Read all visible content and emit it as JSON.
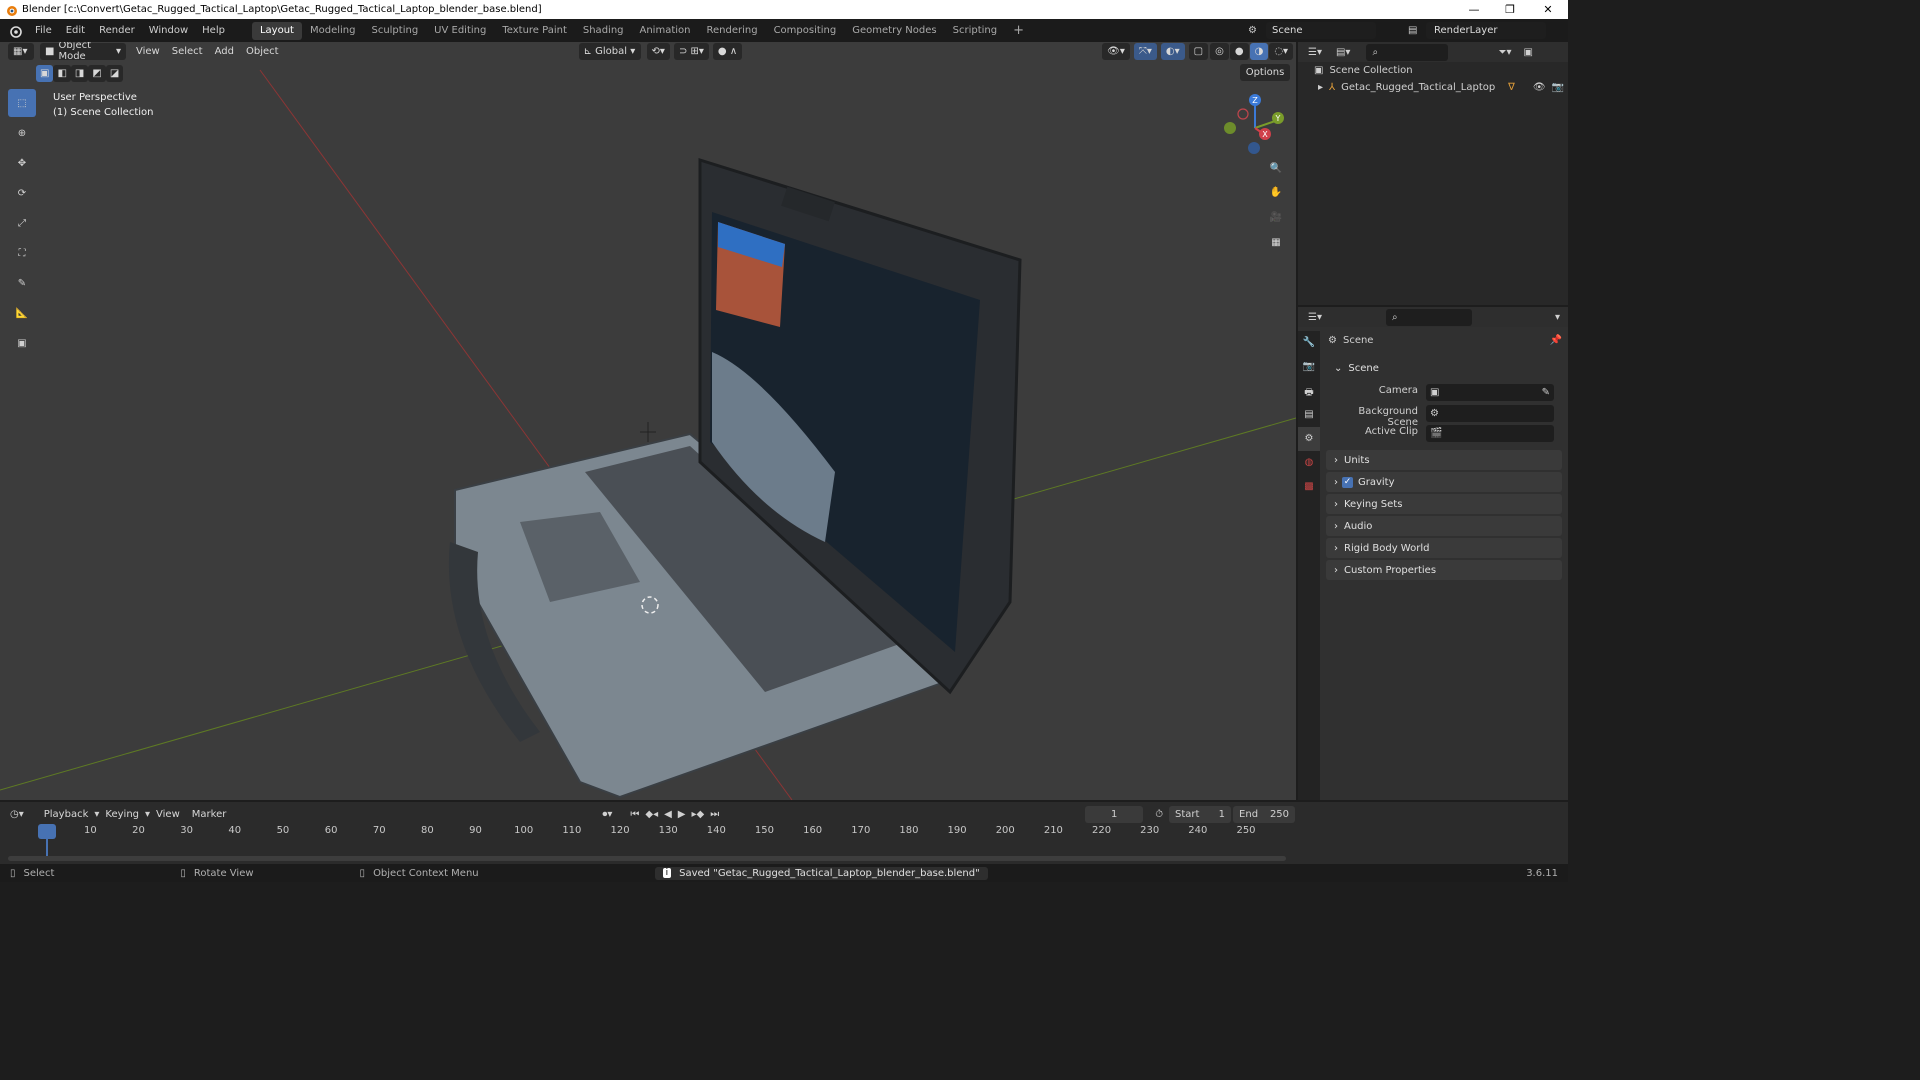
{
  "window": {
    "title": "Blender [c:\\Convert\\Getac_Rugged_Tactical_Laptop\\Getac_Rugged_Tactical_Laptop_blender_base.blend]"
  },
  "menu": {
    "items": [
      "File",
      "Edit",
      "Render",
      "Window",
      "Help"
    ]
  },
  "workspaces": [
    "Layout",
    "Modeling",
    "Sculpting",
    "UV Editing",
    "Texture Paint",
    "Shading",
    "Animation",
    "Rendering",
    "Compositing",
    "Geometry Nodes",
    "Scripting"
  ],
  "scene_selector": {
    "label": "Scene"
  },
  "view_layer": {
    "label": "RenderLayer"
  },
  "viewport": {
    "mode": "Object Mode",
    "menus": [
      "View",
      "Select",
      "Add",
      "Object"
    ],
    "orientation": "Global",
    "options_label": "Options",
    "overlay_line1": "User Perspective",
    "overlay_line2": "(1) Scene Collection",
    "gizmo_axes": {
      "x": "X",
      "y": "Y",
      "z": "Z"
    }
  },
  "outliner": {
    "root": "Scene Collection",
    "items": [
      {
        "label": "Getac_Rugged_Tactical_Laptop"
      }
    ]
  },
  "properties": {
    "header": "Scene",
    "panel_scene": "Scene",
    "fields": {
      "camera": "Camera",
      "background_scene": "Background Scene",
      "active_clip": "Active Clip"
    },
    "panels": [
      "Units",
      "Gravity",
      "Keying Sets",
      "Audio",
      "Rigid Body World",
      "Custom Properties"
    ],
    "gravity_checked": true
  },
  "timeline": {
    "menus": [
      "Playback",
      "Keying",
      "View",
      "Marker"
    ],
    "current_frame": "1",
    "start_label": "Start",
    "start": "1",
    "end_label": "End",
    "end": "250",
    "ticks": [
      "1",
      "10",
      "20",
      "30",
      "40",
      "50",
      "60",
      "70",
      "80",
      "90",
      "100",
      "110",
      "120",
      "130",
      "140",
      "150",
      "160",
      "170",
      "180",
      "190",
      "200",
      "210",
      "220",
      "230",
      "240",
      "250"
    ]
  },
  "status": {
    "select": "Select",
    "rotate": "Rotate View",
    "context": "Object Context Menu",
    "message": "Saved \"Getac_Rugged_Tactical_Laptop_blender_base.blend\"",
    "version": "3.6.11"
  },
  "colors": {
    "accent": "#4772b3",
    "x_axis": "#d0404a",
    "y_axis": "#7a9c2a",
    "z_axis": "#3b7ad8",
    "viewport_bg": "#3c3c3c"
  }
}
